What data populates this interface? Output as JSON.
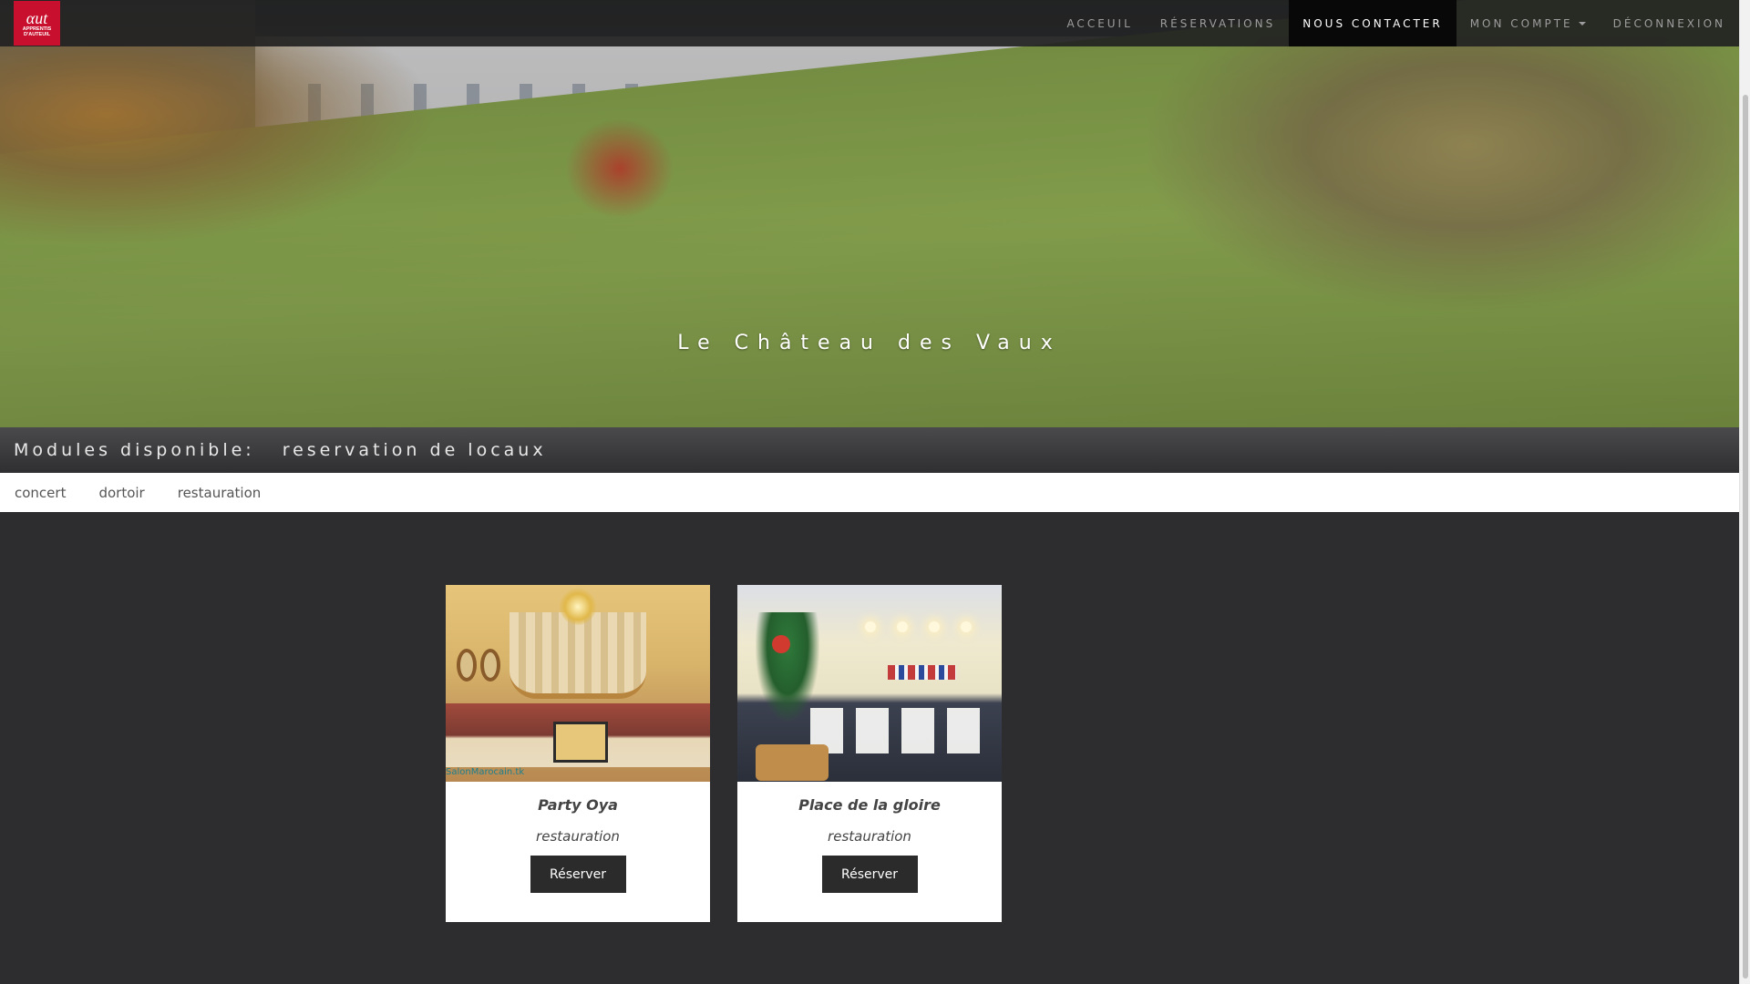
{
  "navbar": {
    "logo_text_1": "APPRENTIS",
    "logo_text_2": "D'AUTEUIL",
    "items": [
      {
        "label": "ACCEUIL"
      },
      {
        "label": "RÉSERVATIONS"
      },
      {
        "label": "NOUS CONTACTER"
      },
      {
        "label": "MON COMPTE"
      },
      {
        "label": "DÉCONNEXION"
      }
    ],
    "active_item": "NOUS CONTACTER"
  },
  "hero": {
    "title": "Le Château des Vaux"
  },
  "modules": {
    "label": "Modules disponible:",
    "value": "reservation de locaux"
  },
  "filters": [
    {
      "label": "concert"
    },
    {
      "label": "dortoir"
    },
    {
      "label": "restauration"
    }
  ],
  "cards": [
    {
      "title": "Party Oya",
      "category": "restauration",
      "button": "Réserver",
      "watermark": "SalonMarocain.tk"
    },
    {
      "title": "Place de la gloire",
      "category": "restauration",
      "button": "Réserver"
    }
  ],
  "colors": {
    "navbar_bg": "#222222",
    "active_nav_bg": "#080808",
    "page_bg": "#2d2d30",
    "logo_red": "#c8102e",
    "button_bg": "#2b2b2b"
  }
}
